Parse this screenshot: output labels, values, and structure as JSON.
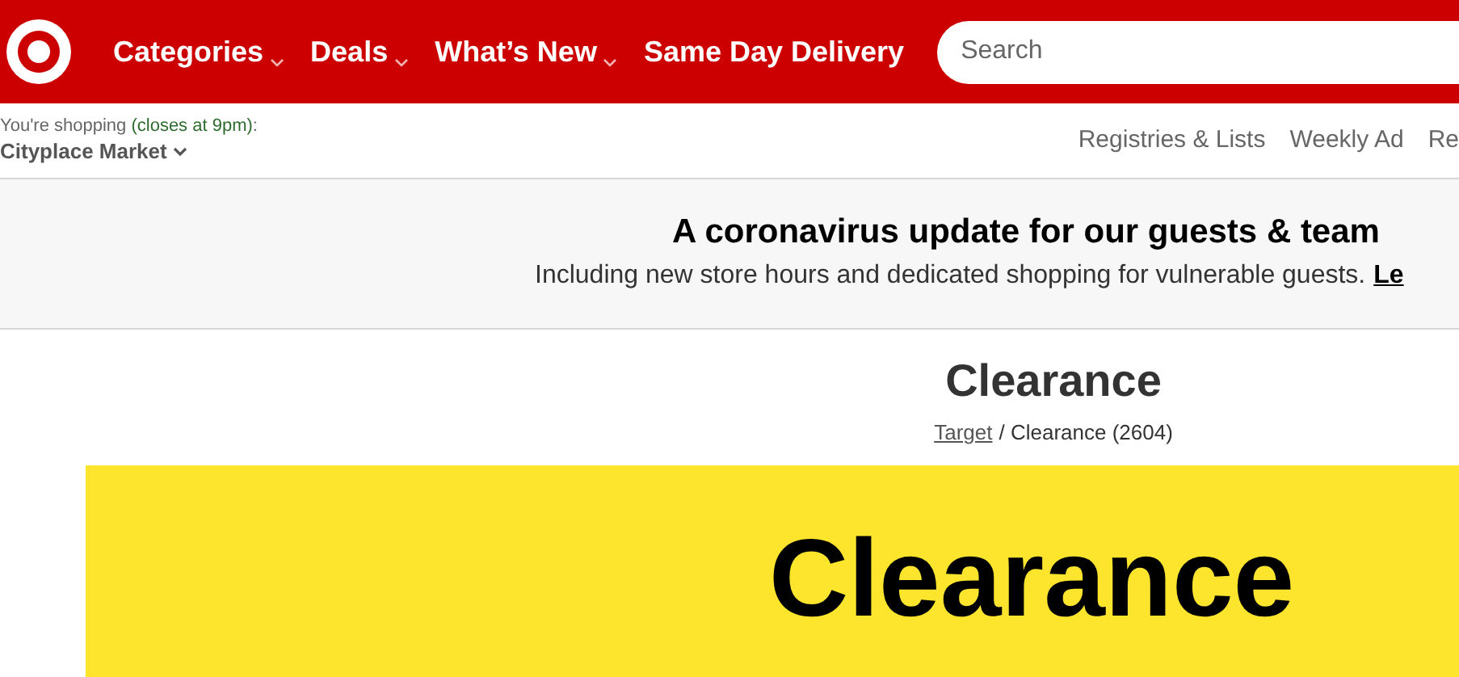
{
  "header": {
    "nav": [
      {
        "label": "Categories",
        "dropdown": true
      },
      {
        "label": "Deals",
        "dropdown": true
      },
      {
        "label": "What’s New",
        "dropdown": true
      },
      {
        "label": "Same Day Delivery",
        "dropdown": false
      }
    ],
    "search": {
      "placeholder": "Search"
    }
  },
  "store_bar": {
    "prefix": "You're shopping",
    "hours": "(closes at 9pm)",
    "suffix": ":",
    "store": "Cityplace Market",
    "links": [
      "Registries & Lists",
      "Weekly Ad",
      "Re"
    ]
  },
  "notice": {
    "title": "A coronavirus update for our guests & team",
    "text": "Including new store hours and dedicated shopping for vulnerable guests.",
    "link": "Le"
  },
  "page": {
    "title": "Clearance",
    "breadcrumb_link": "Target",
    "breadcrumb_rest": "/ Clearance (2604)",
    "banner_text": "Clearance"
  }
}
